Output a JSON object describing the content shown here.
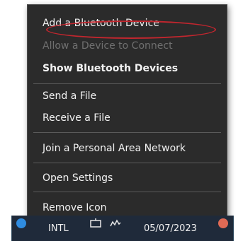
{
  "menu": {
    "items": [
      {
        "label": "Add a Bluetooth Device"
      },
      {
        "label": "Allow a Device to Connect"
      },
      {
        "label": "Show Bluetooth Devices"
      },
      {
        "label": "Send a File"
      },
      {
        "label": "Receive a File"
      },
      {
        "label": "Join a Personal Area Network"
      },
      {
        "label": "Open Settings"
      },
      {
        "label": "Remove Icon"
      }
    ],
    "highlight_color": "#c2262e"
  },
  "taskbar": {
    "language": "INTL",
    "date": "05/07/2023",
    "icons": [
      "bluetooth-icon",
      "network-icon",
      "wifi-icon",
      "notification-icon"
    ]
  }
}
